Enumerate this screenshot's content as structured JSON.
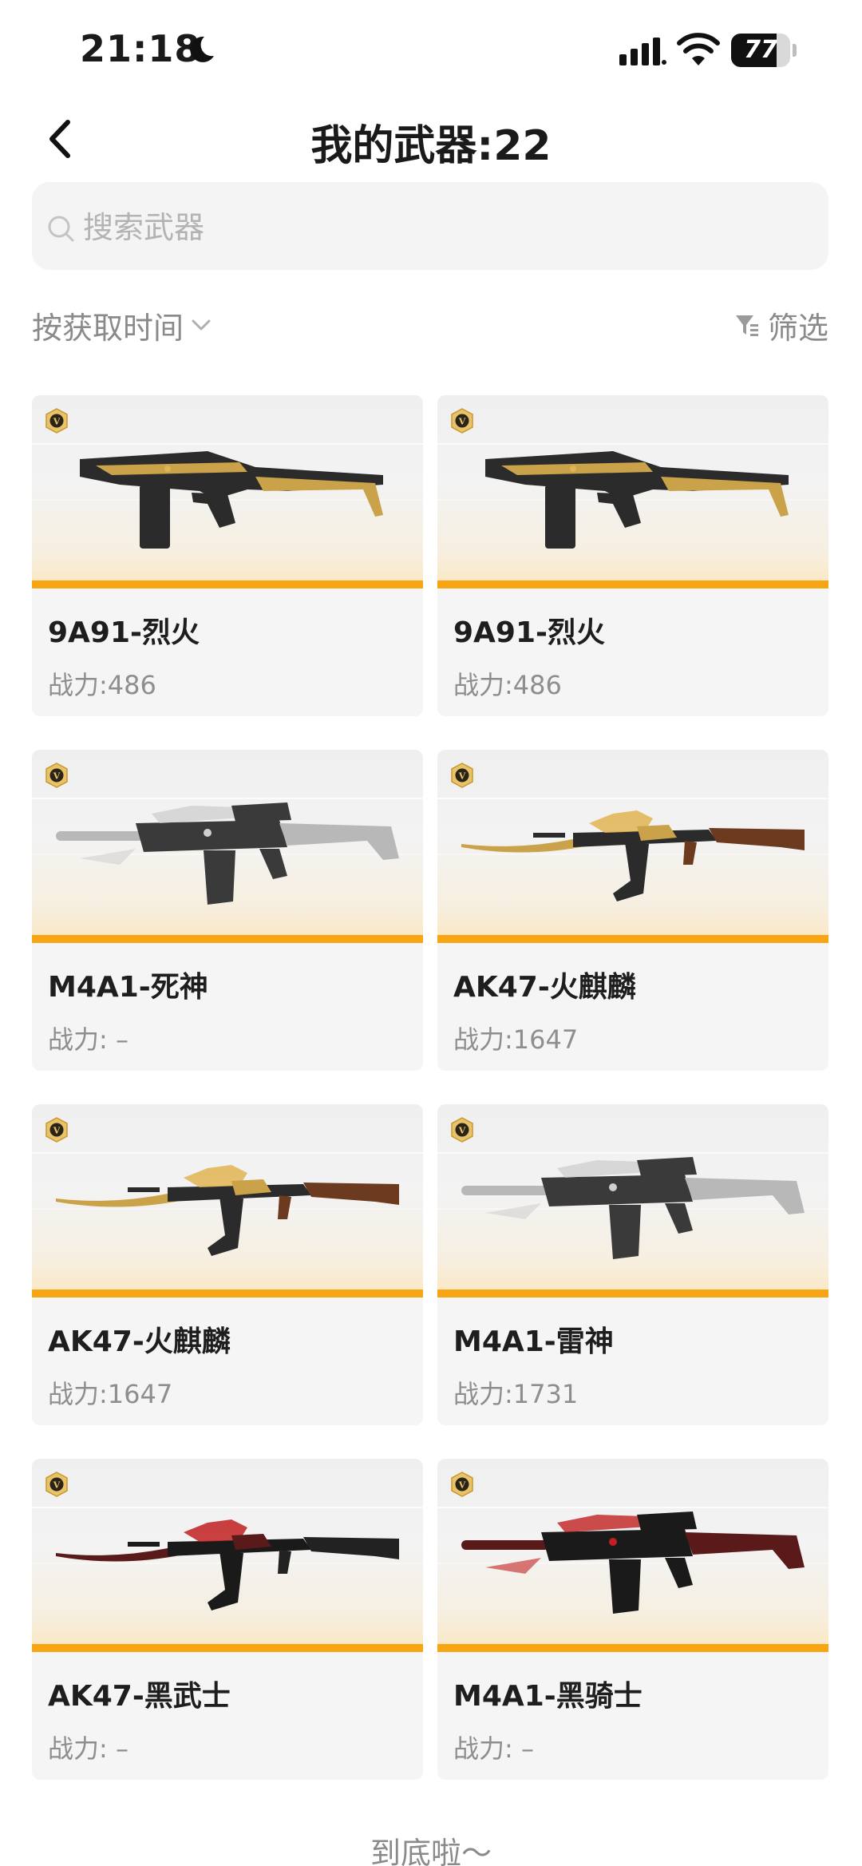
{
  "status_bar": {
    "time": "21:18",
    "battery": "77",
    "battery_level": 0.77
  },
  "header": {
    "title": "我的武器:22"
  },
  "search": {
    "placeholder": "搜索武器"
  },
  "sort": {
    "label": "按获取时间"
  },
  "filter": {
    "label": "筛选"
  },
  "accent_color": "#f7a512",
  "weapons": [
    {
      "name": "9A91-烈火",
      "power": "战力:486",
      "type": "smg",
      "style": "gold"
    },
    {
      "name": "9A91-烈火",
      "power": "战力:486",
      "type": "smg",
      "style": "gold"
    },
    {
      "name": "M4A1-死神",
      "power": "战力: –",
      "type": "m4",
      "style": "silver"
    },
    {
      "name": "AK47-火麒麟",
      "power": "战力:1647",
      "type": "ak",
      "style": "gold"
    },
    {
      "name": "AK47-火麒麟",
      "power": "战力:1647",
      "type": "ak",
      "style": "gold"
    },
    {
      "name": "M4A1-雷神",
      "power": "战力:1731",
      "type": "m4",
      "style": "silver"
    },
    {
      "name": "AK47-黑武士",
      "power": "战力: –",
      "type": "ak",
      "style": "dark"
    },
    {
      "name": "M4A1-黑骑士",
      "power": "战力: –",
      "type": "m4",
      "style": "dark"
    }
  ],
  "footer": {
    "end_text": "到底啦～"
  }
}
